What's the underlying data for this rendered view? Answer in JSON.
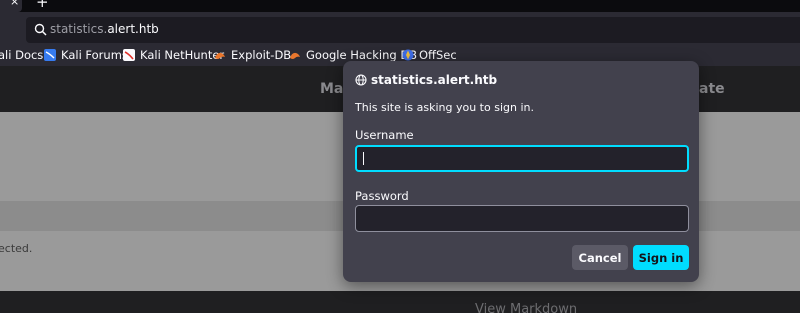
{
  "tabs": {
    "close_symbol": "×",
    "new_tab_symbol": "+"
  },
  "urlbar": {
    "host_prefix": "statistics.",
    "host_domain": "alert.htb"
  },
  "bookmarks": [
    {
      "label": "ali Docs",
      "icon": "kali-icon"
    },
    {
      "label": "Kali Forums",
      "icon": "kali-forums-icon"
    },
    {
      "label": "Kali NetHunter",
      "icon": "nethunter-icon"
    },
    {
      "label": "Exploit-DB",
      "icon": "exploit-db-icon"
    },
    {
      "label": "Google Hacking DB",
      "icon": "ghdb-icon"
    },
    {
      "label": "OffSec",
      "icon": "offsec-icon"
    }
  ],
  "page": {
    "header_left": "Ma",
    "header_right": "ate",
    "body_text": "ected.",
    "footer_link": "View Markdown"
  },
  "dialog": {
    "title": "statistics.alert.htb",
    "message": "This site is asking you to sign in.",
    "username_label": "Username",
    "username_value": "",
    "password_label": "Password",
    "password_value": "",
    "cancel_label": "Cancel",
    "signin_label": "Sign in"
  },
  "colors": {
    "accent": "#00ddff",
    "dialog_bg": "#42414d",
    "toolbar_bg": "#2b2a33"
  }
}
